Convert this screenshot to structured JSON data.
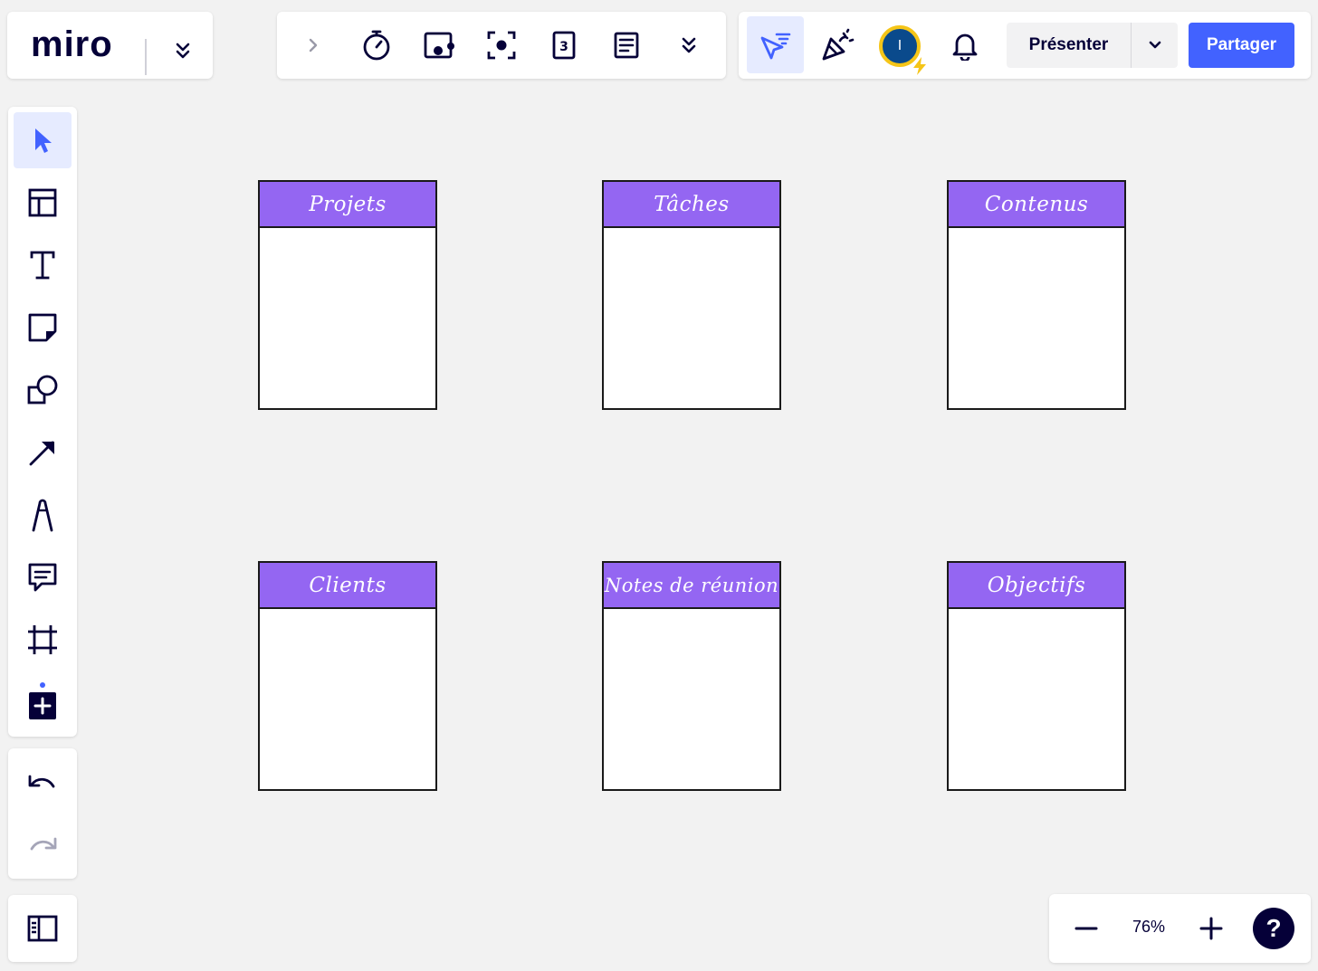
{
  "logo": {
    "text": "miro"
  },
  "header": {
    "present_label": "Présenter",
    "share_label": "Partager",
    "avatar_initial": "I"
  },
  "zoom": {
    "level": "76%",
    "help_label": "?"
  },
  "cards": [
    {
      "title": "Projets"
    },
    {
      "title": "Tâches"
    },
    {
      "title": "Contenus"
    },
    {
      "title": "Clients"
    },
    {
      "title": "Notes de réunion"
    },
    {
      "title": "Objectifs"
    }
  ],
  "colors": {
    "accent": "#4262ff",
    "card_header": "#9466f2",
    "active_tool_bg": "#e6ebff",
    "avatar_bg": "#0a4a8c",
    "avatar_ring": "#f5c518"
  },
  "icons": {
    "top_toolbar": [
      "chevron-right-icon",
      "timer-icon",
      "video-cursor-icon",
      "focus-icon",
      "voting-card-icon",
      "notes-icon",
      "more-icon"
    ],
    "right_toolbar": [
      "cursor-follow-icon",
      "celebrate-icon",
      "avatar",
      "bell-icon"
    ],
    "left_toolbar": [
      "select-icon",
      "templates-icon",
      "text-icon",
      "sticky-note-icon",
      "shapes-icon",
      "arrow-icon",
      "pen-icon",
      "comment-icon",
      "frame-icon",
      "add-apps-icon",
      "undo-icon",
      "redo-icon",
      "panels-icon"
    ]
  }
}
